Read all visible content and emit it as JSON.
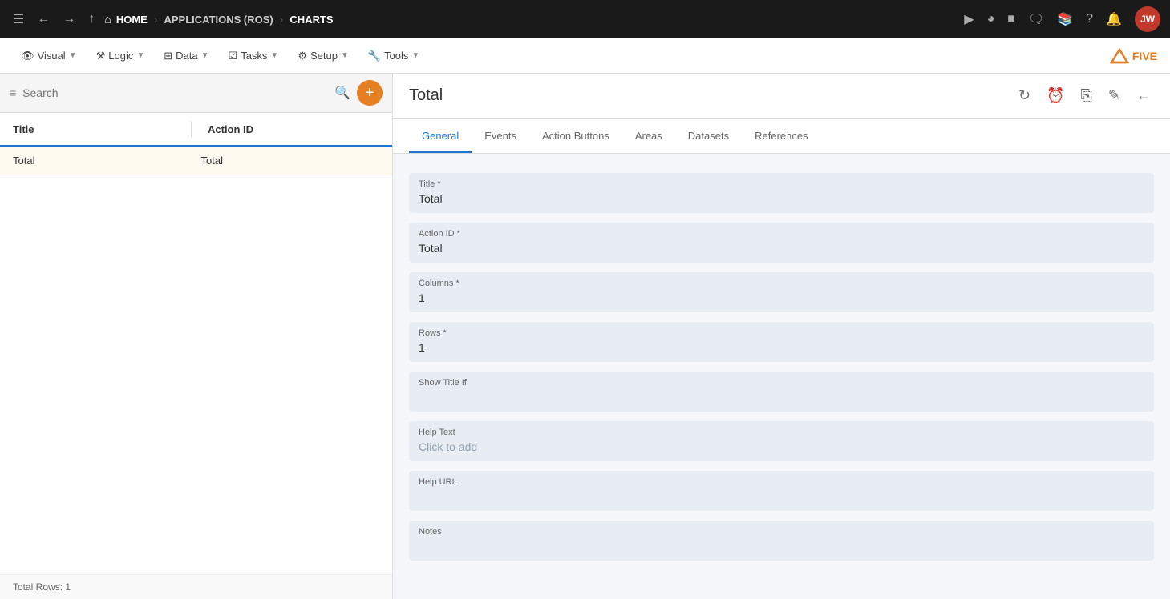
{
  "topnav": {
    "home_label": "HOME",
    "app_label": "APPLICATIONS (ROS)",
    "current_label": "CHARTS",
    "avatar_initials": "JW"
  },
  "secondnav": {
    "items": [
      {
        "icon": "👁",
        "label": "Visual",
        "id": "visual"
      },
      {
        "icon": "⚙",
        "label": "Logic",
        "id": "logic"
      },
      {
        "icon": "⊞",
        "label": "Data",
        "id": "data"
      },
      {
        "icon": "☑",
        "label": "Tasks",
        "id": "tasks"
      },
      {
        "icon": "⚙",
        "label": "Setup",
        "id": "setup"
      },
      {
        "icon": "🔧",
        "label": "Tools",
        "id": "tools"
      }
    ]
  },
  "left_panel": {
    "search_placeholder": "Search",
    "table_headers": {
      "title": "Title",
      "action_id": "Action ID"
    },
    "rows": [
      {
        "title": "Total",
        "action_id": "Total"
      }
    ],
    "footer": "Total Rows: 1"
  },
  "right_panel": {
    "title": "Total",
    "tabs": [
      {
        "label": "General",
        "id": "general",
        "active": true
      },
      {
        "label": "Events",
        "id": "events"
      },
      {
        "label": "Action Buttons",
        "id": "action-buttons"
      },
      {
        "label": "Areas",
        "id": "areas"
      },
      {
        "label": "Datasets",
        "id": "datasets"
      },
      {
        "label": "References",
        "id": "references"
      }
    ],
    "form": {
      "fields": [
        {
          "id": "title",
          "label": "Title *",
          "value": "Total",
          "placeholder": ""
        },
        {
          "id": "action_id",
          "label": "Action ID *",
          "value": "Total",
          "placeholder": ""
        },
        {
          "id": "columns",
          "label": "Columns *",
          "value": "1",
          "placeholder": ""
        },
        {
          "id": "rows",
          "label": "Rows *",
          "value": "1",
          "placeholder": ""
        },
        {
          "id": "show_title_if",
          "label": "Show Title If",
          "value": "",
          "placeholder": ""
        },
        {
          "id": "help_text",
          "label": "Help Text",
          "value": "",
          "placeholder": "Click to add"
        },
        {
          "id": "help_url",
          "label": "Help URL",
          "value": "",
          "placeholder": ""
        },
        {
          "id": "notes",
          "label": "Notes",
          "value": "",
          "placeholder": ""
        }
      ]
    }
  }
}
